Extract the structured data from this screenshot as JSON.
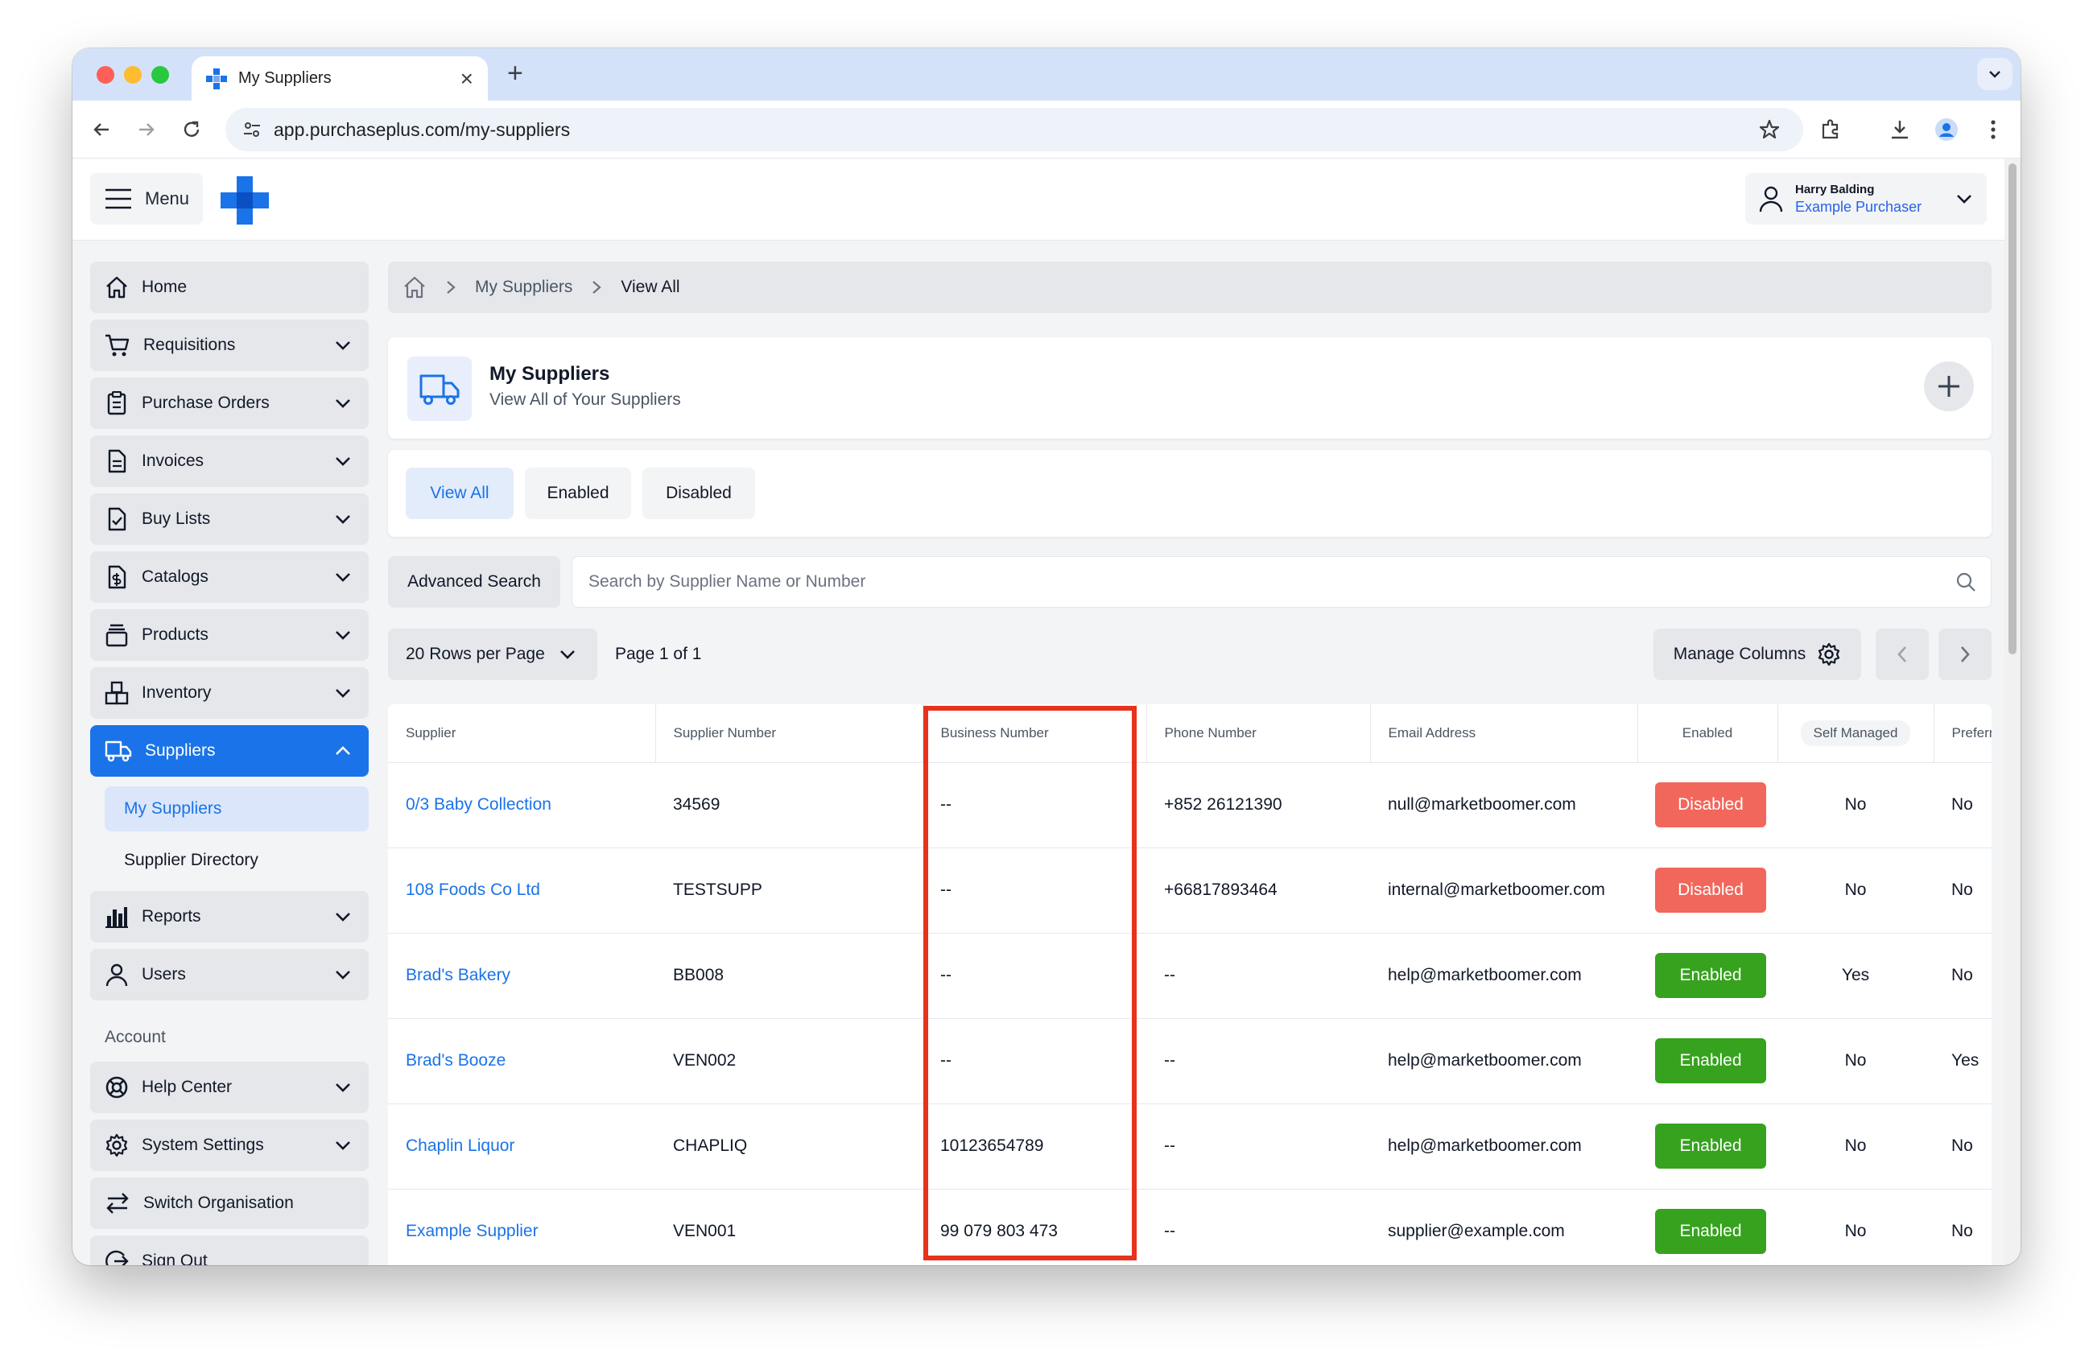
{
  "browser": {
    "tab_title": "My Suppliers",
    "tab_close": "×",
    "new_tab": "+",
    "url": "app.purchaseplus.com/my-suppliers"
  },
  "header": {
    "menu_label": "Menu",
    "user_name": "Harry Balding",
    "user_role": "Example Purchaser"
  },
  "sidebar": {
    "items": [
      {
        "label": "Home"
      },
      {
        "label": "Requisitions"
      },
      {
        "label": "Purchase Orders"
      },
      {
        "label": "Invoices"
      },
      {
        "label": "Buy Lists"
      },
      {
        "label": "Catalogs"
      },
      {
        "label": "Products"
      },
      {
        "label": "Inventory"
      },
      {
        "label": "Suppliers"
      },
      {
        "label": "Reports"
      },
      {
        "label": "Users"
      }
    ],
    "supplier_sub": [
      "My Suppliers",
      "Supplier Directory"
    ],
    "account_label": "Account",
    "account_items": [
      {
        "label": "Help Center"
      },
      {
        "label": "System Settings"
      },
      {
        "label": "Switch Organisation"
      },
      {
        "label": "Sign Out"
      }
    ]
  },
  "breadcrumb": [
    "My Suppliers",
    "View All"
  ],
  "page": {
    "title": "My Suppliers",
    "subtitle": "View All of Your Suppliers"
  },
  "filters": [
    "View All",
    "Enabled",
    "Disabled"
  ],
  "search": {
    "advanced_label": "Advanced Search",
    "placeholder": "Search by Supplier Name or Number"
  },
  "pagination": {
    "rows_label": "20 Rows per Page",
    "page_info": "Page 1 of 1",
    "manage_columns": "Manage Columns"
  },
  "table": {
    "columns": [
      "Supplier",
      "Supplier Number",
      "Business Number",
      "Phone Number",
      "Email Address",
      "Enabled",
      "Self Managed",
      "Preferred"
    ],
    "rows": [
      {
        "supplier": "0/3 Baby Collection",
        "number": "34569",
        "business": "--",
        "phone": "+852 26121390",
        "email": "null@marketboomer.com",
        "status": "Disabled",
        "self_managed": "No",
        "preferred": "No"
      },
      {
        "supplier": "108 Foods Co Ltd",
        "number": "TESTSUPP",
        "business": "--",
        "phone": "+66817893464",
        "email": "internal@marketboomer.com",
        "status": "Disabled",
        "self_managed": "No",
        "preferred": "No"
      },
      {
        "supplier": "Brad's Bakery",
        "number": "BB008",
        "business": "--",
        "phone": "--",
        "email": "help@marketboomer.com",
        "status": "Enabled",
        "self_managed": "Yes",
        "preferred": "No"
      },
      {
        "supplier": "Brad's Booze",
        "number": "VEN002",
        "business": "--",
        "phone": "--",
        "email": "help@marketboomer.com",
        "status": "Enabled",
        "self_managed": "No",
        "preferred": "Yes"
      },
      {
        "supplier": "Chaplin Liquor",
        "number": "CHAPLIQ",
        "business": "10123654789",
        "phone": "--",
        "email": "help@marketboomer.com",
        "status": "Enabled",
        "self_managed": "No",
        "preferred": "No"
      },
      {
        "supplier": "Example Supplier",
        "number": "VEN001",
        "business": "99 079 803 473",
        "phone": "--",
        "email": "supplier@example.com",
        "status": "Enabled",
        "self_managed": "No",
        "preferred": "No"
      }
    ]
  },
  "colors": {
    "accent": "#1a73e8",
    "disabled_badge": "#f1675b",
    "enabled_badge": "#36a21e",
    "highlight_box": "#e8321c"
  },
  "icons": {
    "home": "home-icon",
    "cart": "cart-icon",
    "clipboard": "clipboard-icon",
    "document": "document-icon",
    "checklist": "checklist-icon",
    "catalog": "dollar-document-icon",
    "products": "stack-icon",
    "inventory": "boxes-icon",
    "truck": "truck-icon",
    "reports": "bar-chart-icon",
    "user": "user-icon",
    "help": "lifebuoy-icon",
    "settings": "gear-icon",
    "switch": "switch-arrows-icon",
    "signout": "sign-out-icon"
  }
}
